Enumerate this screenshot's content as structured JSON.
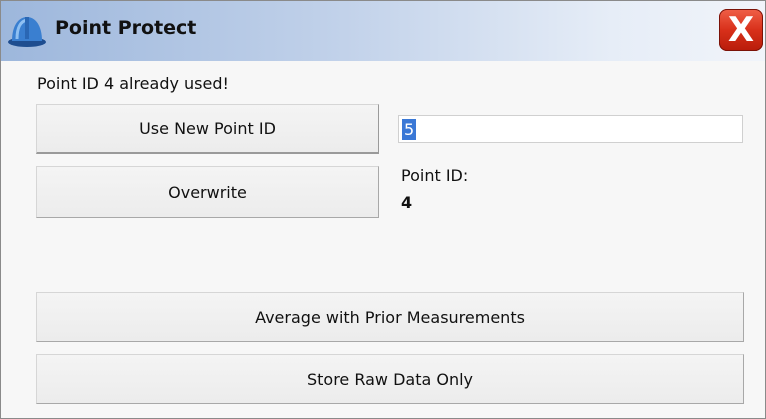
{
  "window": {
    "title": "Point Protect",
    "app_icon": "hard-hat-icon",
    "close_glyph": "X",
    "accent": "#9db7dc",
    "close_color": "#d8301a"
  },
  "message": "Point ID 4 already used!",
  "buttons": {
    "use_new_point_id": "Use New Point ID",
    "overwrite": "Overwrite",
    "average": "Average with Prior Measurements",
    "store_raw": "Store Raw Data Only"
  },
  "new_point_id_input": {
    "value": "5",
    "selected": true
  },
  "point_id": {
    "label": "Point ID:",
    "value": "4"
  }
}
